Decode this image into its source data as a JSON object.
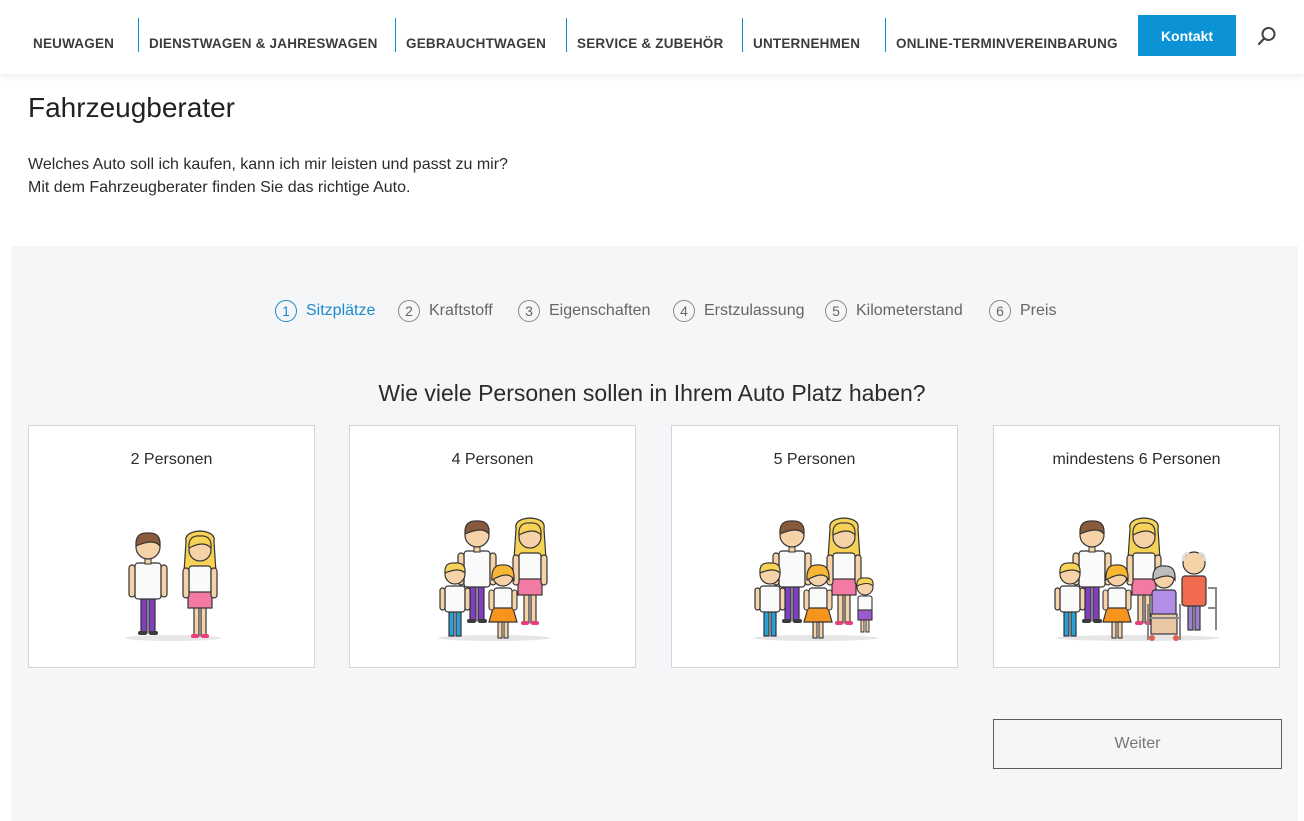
{
  "nav": {
    "items": [
      "NEUWAGEN",
      "DIENSTWAGEN & JAHRESWAGEN",
      "GEBRAUCHTWAGEN",
      "SERVICE & ZUBEHÖR",
      "UNTERNEHMEN",
      "ONLINE-TERMINVEREINBARUNG"
    ],
    "contact_label": "Kontakt",
    "search_icon": "search-icon"
  },
  "page": {
    "title": "Fahrzeugberater",
    "intro_line1": "Welches Auto soll ich kaufen, kann ich mir leisten und passt zu mir?",
    "intro_line2": "Mit dem Fahrzeugberater finden Sie das richtige Auto."
  },
  "steps": [
    {
      "num": "1",
      "label": "Sitzplätze",
      "active": true
    },
    {
      "num": "2",
      "label": "Kraftstoff",
      "active": false
    },
    {
      "num": "3",
      "label": "Eigenschaften",
      "active": false
    },
    {
      "num": "4",
      "label": "Erstzulassung",
      "active": false
    },
    {
      "num": "5",
      "label": "Kilometerstand",
      "active": false
    },
    {
      "num": "6",
      "label": "Preis",
      "active": false
    }
  ],
  "question": "Wie viele Personen sollen in Ihrem Auto Platz haben?",
  "options": [
    {
      "label": "2 Personen",
      "icon": "couple-icon"
    },
    {
      "label": "4 Personen",
      "icon": "family-of-four-icon"
    },
    {
      "label": "5 Personen",
      "icon": "family-of-five-icon"
    },
    {
      "label": "mindestens 6 Personen",
      "icon": "large-family-icon"
    }
  ],
  "next_button": "Weiter",
  "colors": {
    "accent": "#0b93d6",
    "panel_bg": "#f5f6f8",
    "active_step": "#1a8acb"
  }
}
